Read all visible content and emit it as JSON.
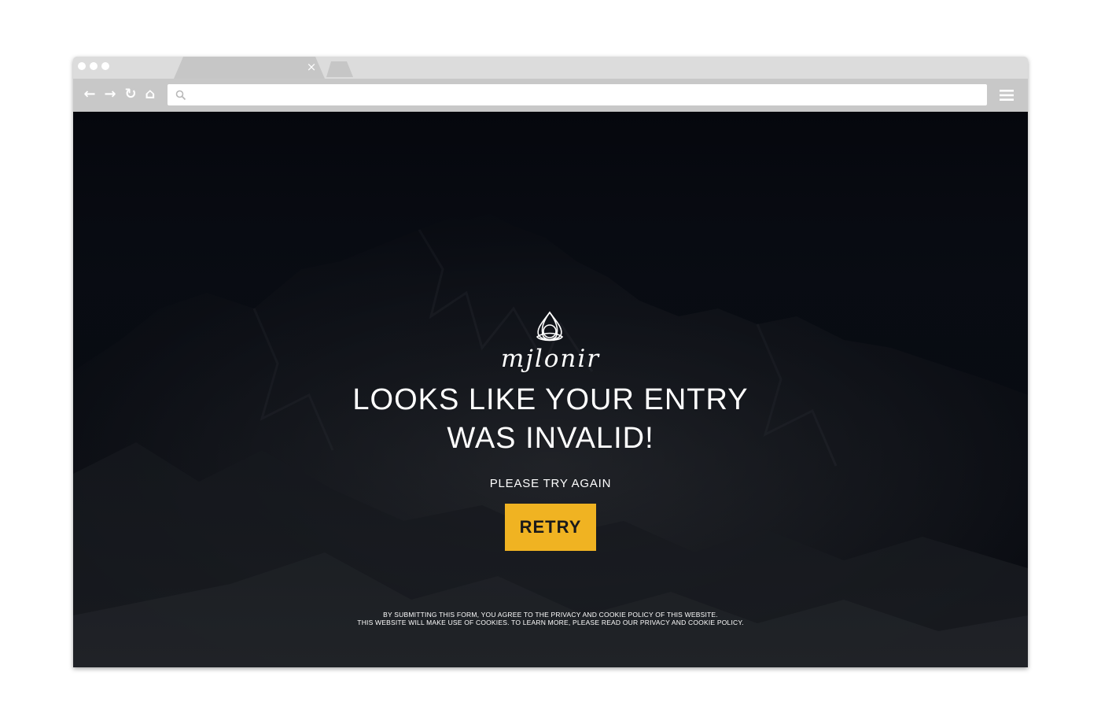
{
  "browser": {
    "tab_close_glyph": "×",
    "address_bar": {
      "value": "",
      "placeholder": ""
    },
    "nav": {
      "back": "←",
      "forward": "→",
      "reload": "↻",
      "home": "⌂"
    },
    "icons": [
      "search-icon",
      "menu-icon",
      "close-icon",
      "back-arrow-icon",
      "forward-arrow-icon",
      "reload-icon",
      "home-icon"
    ]
  },
  "page": {
    "brand": "mjlonir",
    "headline_line1": "LOOKS LIKE YOUR ENTRY",
    "headline_line2": "WAS INVALID!",
    "subtext": "PLEASE TRY AGAIN",
    "retry_label": "RETRY",
    "legal_line1": "BY SUBMITTING THIS FORM, YOU AGREE TO THE PRIVACY AND COOKIE POLICY OF THIS WEBSITE.",
    "legal_line2": "THIS WEBSITE WILL MAKE USE OF COOKIES. TO LEARN MORE, PLEASE READ OUR PRIVACY AND COOKIE POLICY."
  },
  "colors": {
    "accent": "#f0b322",
    "background": "#0a0d14",
    "text": "#ffffff",
    "browser_chrome": "#c8c8c8"
  }
}
